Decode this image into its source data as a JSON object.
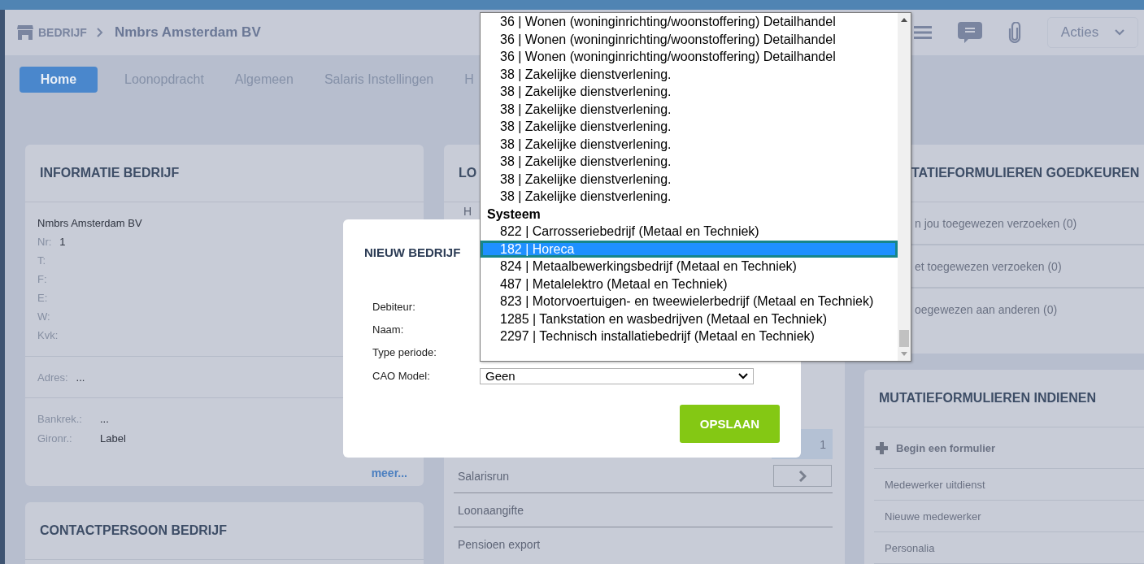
{
  "breadcrumb": {
    "section": "BEDRIJF",
    "company": "Nmbrs Amsterdam BV"
  },
  "actions_menu": {
    "label": "Acties"
  },
  "tabs": [
    {
      "label": "Home",
      "selected": true
    },
    {
      "label": "Loonopdracht",
      "selected": false
    },
    {
      "label": "Algemeen",
      "selected": false
    },
    {
      "label": "Salaris Instellingen",
      "selected": false
    },
    {
      "label": "H",
      "selected": false
    }
  ],
  "info_panel": {
    "title": "INFORMATIE BEDRIJF",
    "name": "Nmbrs Amsterdam BV",
    "fields": [
      {
        "label": "Nr:",
        "value": "1"
      },
      {
        "label": "T:"
      },
      {
        "label": "F:"
      },
      {
        "label": "E:"
      },
      {
        "label": "W:"
      },
      {
        "label": "Kvk:"
      }
    ],
    "address": {
      "label": "Adres:",
      "value": "..."
    },
    "bank": [
      {
        "label": "Bankrek.:",
        "value": "..."
      },
      {
        "label": "Gironr.:",
        "value": "Label"
      }
    ],
    "more_link": "meer..."
  },
  "contact_panel": {
    "title": "CONTACTPERSOON BEDRIJF"
  },
  "middle_panel": {
    "title": "LO",
    "first_item": "H",
    "cell": "1",
    "items": [
      "Salarisrun",
      "Loonaangifte",
      "Pensioen export"
    ]
  },
  "approve_panel": {
    "title": "TATIEFORMULIEREN GOEDKEUREN",
    "items": [
      "n jou toegewezen verzoeken (0)",
      "et toegewezen verzoeken (0)",
      "oegewezen aan anderen (0)"
    ]
  },
  "submit_panel": {
    "title": "MUTATIEFORMULIEREN INDIENEN",
    "start": "Begin een formulier",
    "items": [
      "Medewerker uitdienst",
      "Nieuwe medewerker",
      "Personalia"
    ]
  },
  "dialog": {
    "title": "NIEUW BEDRIJF",
    "fields": [
      {
        "label": "Debiteur:"
      },
      {
        "label": "Naam:"
      },
      {
        "label": "Type periode:"
      },
      {
        "label": "CAO Model:",
        "value": "Geen"
      }
    ],
    "save": "OPSLAAN"
  },
  "dropdown": {
    "options": [
      {
        "kind": "option",
        "label": "36 | Wonen (woninginrichting/woonstoffering) Detailhandel",
        "selected": false
      },
      {
        "kind": "option",
        "label": "36 | Wonen (woninginrichting/woonstoffering) Detailhandel",
        "selected": false
      },
      {
        "kind": "option",
        "label": "36 | Wonen (woninginrichting/woonstoffering) Detailhandel",
        "selected": false
      },
      {
        "kind": "option",
        "label": "38 | Zakelijke dienstverlening.",
        "selected": false
      },
      {
        "kind": "option",
        "label": "38 | Zakelijke dienstverlening.",
        "selected": false
      },
      {
        "kind": "option",
        "label": "38 | Zakelijke dienstverlening.",
        "selected": false
      },
      {
        "kind": "option",
        "label": "38 | Zakelijke dienstverlening.",
        "selected": false
      },
      {
        "kind": "option",
        "label": "38 | Zakelijke dienstverlening.",
        "selected": false
      },
      {
        "kind": "option",
        "label": "38 | Zakelijke dienstverlening.",
        "selected": false
      },
      {
        "kind": "option",
        "label": "38 | Zakelijke dienstverlening.",
        "selected": false
      },
      {
        "kind": "option",
        "label": "38 | Zakelijke dienstverlening.",
        "selected": false
      },
      {
        "kind": "group",
        "label": "Systeem",
        "selected": false
      },
      {
        "kind": "option",
        "label": "822 | Carrosseriebedrijf (Metaal en Techniek)",
        "selected": false
      },
      {
        "kind": "option",
        "label": "182 | Horeca",
        "selected": true
      },
      {
        "kind": "option",
        "label": "824 | Metaalbewerkingsbedrijf (Metaal en Techniek)",
        "selected": false
      },
      {
        "kind": "option",
        "label": "487 | Metalelektro (Metaal en Techniek)",
        "selected": false
      },
      {
        "kind": "option",
        "label": "823 | Motorvoertuigen- en tweewielerbedrijf (Metaal en Techniek)",
        "selected": false
      },
      {
        "kind": "option",
        "label": "1285 | Tankstation en wasbedrijven (Metaal en Techniek)",
        "selected": false
      },
      {
        "kind": "option",
        "label": "2297 | Technisch installatiebedrijf (Metaal en Techniek)",
        "selected": false
      }
    ]
  }
}
